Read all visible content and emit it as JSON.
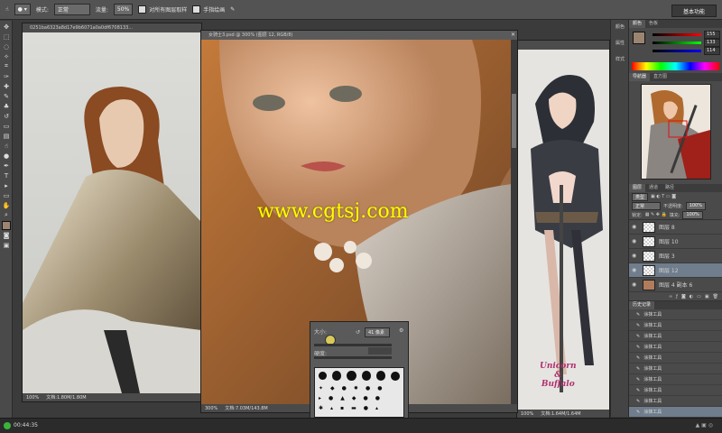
{
  "options_bar": {
    "mode_label": "模式:",
    "mode_value": "正常",
    "opacity_label": "不透明度:",
    "opacity_value": "100%",
    "flow_label": "流量:",
    "flow_value": "50%",
    "sample_all": "对所有图层取样",
    "smoothing": "手指绘画",
    "workspace": "基本功能"
  },
  "documents": {
    "left": {
      "title": "0251ba6323a8d17e9b6071a0a0df6708133...",
      "zoom": "100%",
      "status": "文档:1.80M/1.80M"
    },
    "center": {
      "title": "女骑士3.psd @ 300% (图层 12, RGB/8)",
      "zoom": "300%",
      "status": "文档:7.03M/143.8M"
    },
    "right": {
      "zoom": "100%",
      "status": "文档:1.64M/1.64M"
    }
  },
  "watermark": "www.cgtsj.com",
  "artwork_text": {
    "line1": "Unicorn",
    "line2": "&",
    "line3": "Buffalo"
  },
  "right_col_labels": [
    "颜色",
    "属性",
    "样式"
  ],
  "color_panel": {
    "tabs": [
      "颜色",
      "色板"
    ],
    "values": [
      "155",
      "133",
      "114"
    ]
  },
  "navigator_tabs": [
    "导航器",
    "直方图"
  ],
  "layers_panel": {
    "tabs": [
      "图层",
      "通道",
      "路径"
    ],
    "kind_label": "类型",
    "blend_mode": "正常",
    "opacity_label": "不透明度:",
    "opacity": "100%",
    "lock_label": "锁定:",
    "fill_label": "填充:",
    "fill": "100%",
    "layers": [
      {
        "name": "图层 8",
        "selected": false
      },
      {
        "name": "图层 10",
        "selected": false
      },
      {
        "name": "图层 3",
        "selected": false
      },
      {
        "name": "图层 12",
        "selected": true
      },
      {
        "name": "图层 4 副本 6",
        "selected": false
      }
    ]
  },
  "history_panel": {
    "tab": "历史记录",
    "items": [
      "涂抹工具",
      "涂抹工具",
      "涂抹工具",
      "涂抹工具",
      "涂抹工具",
      "涂抹工具",
      "涂抹工具",
      "涂抹工具",
      "涂抹工具",
      "涂抹工具"
    ]
  },
  "brush_popup": {
    "size_label": "大小:",
    "size_value": "41 像素",
    "hardness_label": "硬度:"
  },
  "taskbar": {
    "time": "00:44:35"
  },
  "colors": {
    "accent_yellow": "#ffff00",
    "panel_bg": "#4a4a4a",
    "canvas_bg": "#3b3b3b"
  }
}
